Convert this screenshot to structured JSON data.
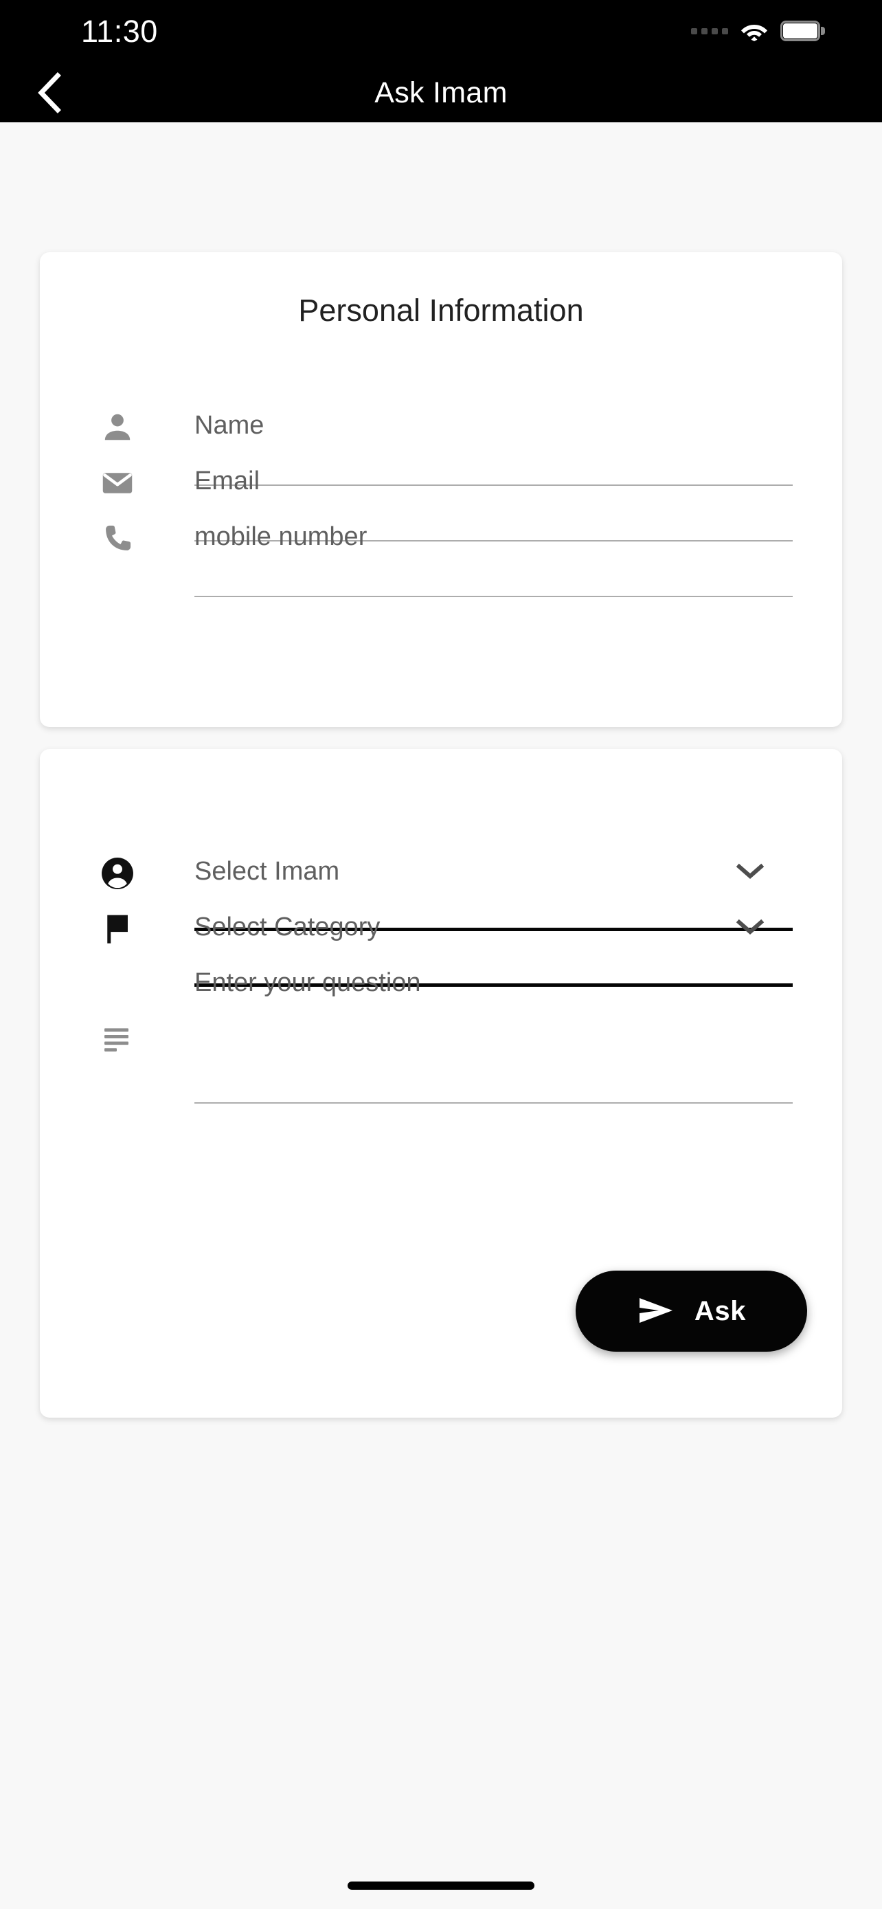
{
  "status_bar": {
    "time": "11:30",
    "signal_icon": "signal-dots-icon",
    "wifi_icon": "wifi-icon",
    "battery_icon": "battery-full-icon"
  },
  "app_bar": {
    "title": "Ask Imam",
    "back_icon": "chevron-left-icon"
  },
  "personal_card": {
    "title": "Personal Information",
    "fields": [
      {
        "icon": "person-icon",
        "placeholder": "Name"
      },
      {
        "icon": "email-icon",
        "placeholder": "Email"
      },
      {
        "icon": "phone-icon",
        "placeholder": "mobile number"
      }
    ]
  },
  "question_card": {
    "selects": [
      {
        "icon": "account-circle-icon",
        "placeholder": "Select Imam",
        "chevron": "chevron-down-icon",
        "value": ""
      },
      {
        "icon": "flag-icon",
        "placeholder": "Select Category",
        "chevron": "chevron-down-icon",
        "value": ""
      }
    ],
    "question": {
      "icon": "notes-icon",
      "placeholder": "Enter your question",
      "value": ""
    },
    "submit": {
      "label": "Ask",
      "icon": "send-icon"
    }
  },
  "colors": {
    "appbar_bg": "#000000",
    "page_bg": "#f8f8f8",
    "card_bg": "#ffffff",
    "placeholder": "#5f5f5f",
    "underline_light": "#adadad",
    "underline_bold": "#050505",
    "accent": "#050505"
  }
}
